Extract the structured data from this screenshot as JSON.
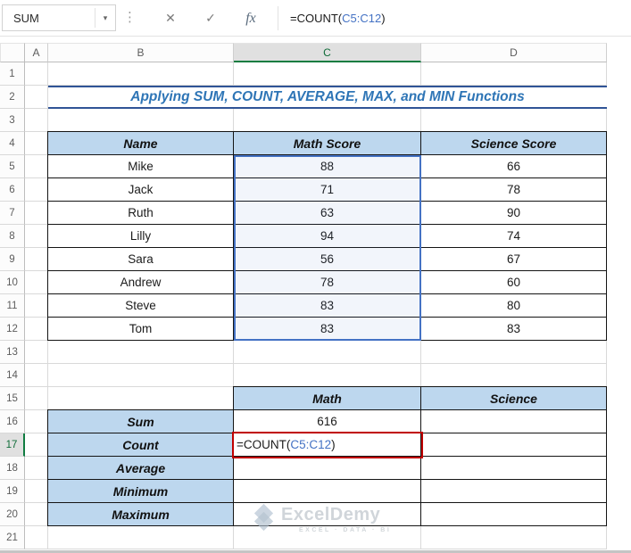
{
  "toolbar": {
    "name_box_value": "SUM",
    "cancel": "✕",
    "enter": "✓",
    "fx": "fx",
    "icons": {
      "name_box_dropdown": "▾",
      "options_dots": "⋮"
    },
    "formula": {
      "prefix": "=COUNT(",
      "reference": "C5:C12",
      "suffix": ")"
    }
  },
  "grid": {
    "columns": [
      "A",
      "B",
      "C",
      "D"
    ],
    "rows": [
      "1",
      "2",
      "3",
      "4",
      "5",
      "6",
      "7",
      "8",
      "9",
      "10",
      "11",
      "12",
      "13",
      "14",
      "15",
      "16",
      "17",
      "18",
      "19",
      "20",
      "21"
    ]
  },
  "sheet": {
    "title": "Applying SUM, COUNT, AVERAGE, MAX, and MIN Functions",
    "scores": {
      "headers": {
        "name": "Name",
        "math": "Math Score",
        "science": "Science Score"
      },
      "rows": [
        {
          "name": "Mike",
          "math": "88",
          "science": "66"
        },
        {
          "name": "Jack",
          "math": "71",
          "science": "78"
        },
        {
          "name": "Ruth",
          "math": "63",
          "science": "90"
        },
        {
          "name": "Lilly",
          "math": "94",
          "science": "74"
        },
        {
          "name": "Sara",
          "math": "56",
          "science": "67"
        },
        {
          "name": "Andrew",
          "math": "78",
          "science": "60"
        },
        {
          "name": "Steve",
          "math": "83",
          "science": "80"
        },
        {
          "name": "Tom",
          "math": "83",
          "science": "83"
        }
      ]
    },
    "summary": {
      "headers": {
        "math": "Math",
        "science": "Science"
      },
      "labels": [
        "Sum",
        "Count",
        "Average",
        "Minimum",
        "Maximum"
      ],
      "sum_value": "616",
      "count_formula": {
        "prefix": "=COUNT(",
        "reference": "C5:C12",
        "suffix": ")"
      }
    }
  },
  "watermark": {
    "brand": "ExcelDemy",
    "tagline": "EXCEL · DATA · BI"
  },
  "colors": {
    "header_fill": "#BDD7EE",
    "title_text": "#2E75B6",
    "reference_blue": "#4472C4",
    "active_cell_red": "#C00000",
    "selection_green": "#107C41"
  }
}
